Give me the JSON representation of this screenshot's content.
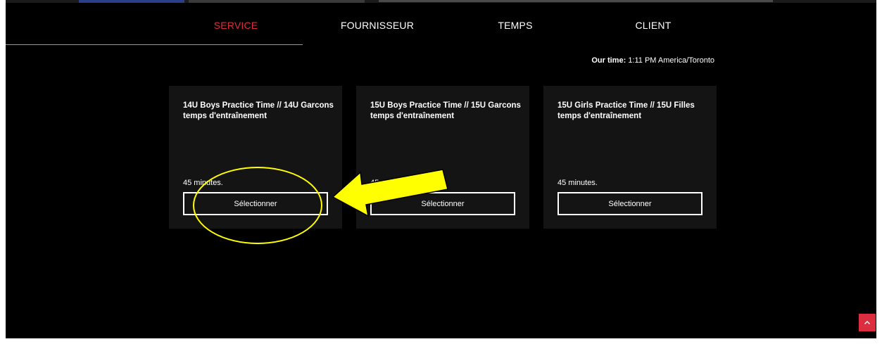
{
  "colors": {
    "accent": "#dc2e3f",
    "background": "#000000",
    "card": "#141414",
    "annotation_yellow": "#ffff00"
  },
  "tabs": [
    {
      "label": "SERVICE",
      "active": true
    },
    {
      "label": "FOURNISSEUR",
      "active": false
    },
    {
      "label": "TEMPS",
      "active": false
    },
    {
      "label": "CLIENT",
      "active": false
    }
  ],
  "our_time": {
    "label": "Our time:",
    "value": "1:11 PM America/Toronto"
  },
  "services": [
    {
      "title": "14U Boys Practice Time // 14U Garcons temps d'entraînement",
      "duration": "45 minutes.",
      "button": "Sélectionner"
    },
    {
      "title": "15U Boys Practice Time // 15U Garcons temps d'entraînement",
      "duration": "45 minutes.",
      "button": "Sélectionner"
    },
    {
      "title": "15U Girls Practice Time // 15U Filles temps d'entraînement",
      "duration": "45 minutes.",
      "button": "Sélectionner"
    }
  ],
  "scroll_top_icon": "chevron-up-icon",
  "annotation_icons": [
    "highlight-ellipse",
    "arrow-left-icon"
  ]
}
